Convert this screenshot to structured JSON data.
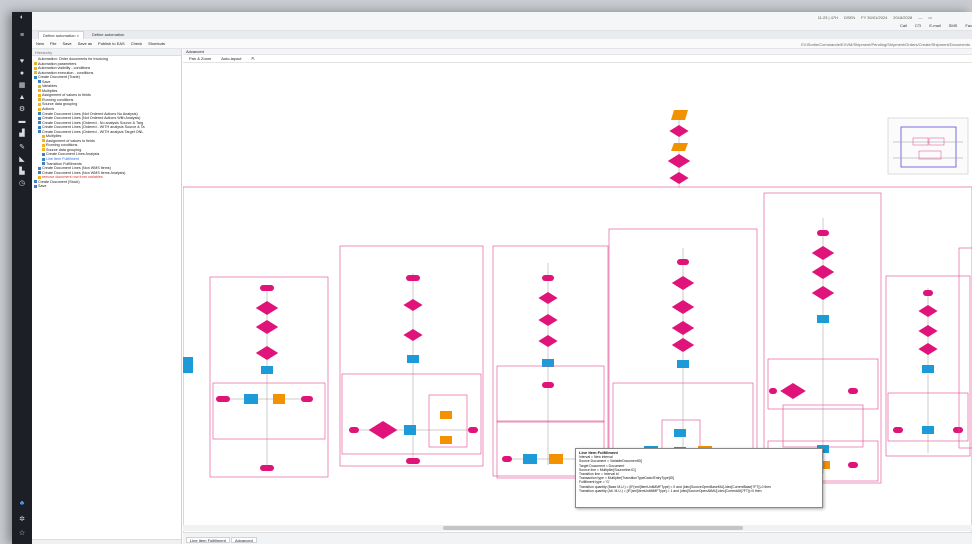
{
  "window": {
    "status_items": [
      "11:23 | 47H",
      "DSEN",
      "FY 30/01/2024",
      "2018/2028"
    ],
    "actions": [
      "Call",
      "CTI",
      "E-mail",
      "SMS",
      "Fax"
    ]
  },
  "tabs": [
    {
      "label": "Define automation"
    },
    {
      "label": "Define automation"
    }
  ],
  "toolbar": {
    "items": [
      "New",
      "File",
      "Save",
      "Save as",
      "Publish to EAS",
      "Check",
      "Shortcuts"
    ],
    "path": "EXISortie/Commande/EXVM/Shipment/Pending/Shipment/Orders/Create/Shipment/Documents"
  },
  "hierarchy": {
    "header": "Hierarchy",
    "items": [
      {
        "label": "Automation: Order documents for invoicing",
        "indent": 0,
        "icon": "none",
        "color": "#222"
      },
      {
        "label": "Automation parameters",
        "indent": 0,
        "icon": "folder",
        "color": "#222"
      },
      {
        "label": "Automation visibility - conditions",
        "indent": 0,
        "icon": "folder",
        "color": "#222"
      },
      {
        "label": "Automation execution - conditions",
        "indent": 0,
        "icon": "folder",
        "color": "#222"
      },
      {
        "label": "Create Document (Trade)",
        "indent": 0,
        "icon": "doc",
        "color": "#222"
      },
      {
        "label": "Save",
        "indent": 1,
        "icon": "doc",
        "color": "#222"
      },
      {
        "label": "Variables",
        "indent": 1,
        "icon": "folder",
        "color": "#222"
      },
      {
        "label": "Multiplies",
        "indent": 1,
        "icon": "folder",
        "color": "#222"
      },
      {
        "label": "Assignment of values to fields",
        "indent": 1,
        "icon": "folder",
        "color": "#222"
      },
      {
        "label": "Running conditions",
        "indent": 1,
        "icon": "folder",
        "color": "#222"
      },
      {
        "label": "Source data grouping",
        "indent": 1,
        "icon": "folder",
        "color": "#222"
      },
      {
        "label": "Actions",
        "indent": 1,
        "icon": "folder",
        "color": "#222"
      },
      {
        "label": "Create Document Lines (Not Ordered Actions No Analysis)",
        "indent": 1,
        "icon": "doc",
        "color": "#222"
      },
      {
        "label": "Create Document Lines (Not Ordered Actions With Analysis)",
        "indent": 1,
        "icon": "doc",
        "color": "#222"
      },
      {
        "label": "Create Document Lines (Ordered - No analysis Source & Targ",
        "indent": 1,
        "icon": "doc",
        "color": "#222"
      },
      {
        "label": "Create Document Lines (Ordered - WITH analysis Source & Ta",
        "indent": 1,
        "icon": "doc",
        "color": "#222"
      },
      {
        "label": "Create Document Lines (Ordered - WITH analysis Target ONL",
        "indent": 1,
        "icon": "doc",
        "color": "#222"
      },
      {
        "label": "Multiplies",
        "indent": 2,
        "icon": "folder",
        "color": "#222"
      },
      {
        "label": "Assignment of values to fields",
        "indent": 2,
        "icon": "folder",
        "color": "#222"
      },
      {
        "label": "Running conditions",
        "indent": 2,
        "icon": "folder",
        "color": "#222"
      },
      {
        "label": "Source data grouping",
        "indent": 2,
        "icon": "folder",
        "color": "#222"
      },
      {
        "label": "Create Document Lines Analysis",
        "indent": 2,
        "icon": "doc",
        "color": "#222"
      },
      {
        "label": "Line Item Fulfillment",
        "indent": 2,
        "icon": "doc",
        "color": "#2a6fd6"
      },
      {
        "label": "Transition Fulfillments",
        "indent": 2,
        "icon": "doc",
        "color": "#222"
      },
      {
        "label": "Create Document Lines (Non WMS items)",
        "indent": 1,
        "icon": "doc",
        "color": "#222"
      },
      {
        "label": "Create Document Lines (Non WMS items Analysis)",
        "indent": 1,
        "icon": "doc",
        "color": "#222"
      },
      {
        "label": "remove document row from variables",
        "indent": 1,
        "icon": "warn",
        "color": "#d32f2f"
      },
      {
        "label": "Create Document (Stock)",
        "indent": 0,
        "icon": "doc",
        "color": "#222"
      },
      {
        "label": "Save",
        "indent": 0,
        "icon": "doc",
        "color": "#222"
      }
    ]
  },
  "editor": {
    "title": "Advanced",
    "tools": [
      "Pan & Zoom",
      "Auto-layout"
    ]
  },
  "tooltip": {
    "title": "Line Item Fulfillment",
    "lines": [
      "Interval = New interval",
      "Source Document = VariableDocumentID]",
      "Target Document = Document",
      "Source line = Multiplier[Sourceline.ID]",
      "Transition line = Interval id",
      "Transaction type = Multiplier[TransitionTypeData fEntryType]ID]",
      "Fulfillment type = 'G'",
      "Transition quantity (Base M.U.) = [IF(xml[ItemUnitMMFType] = 0 and (idec[SourceOpenBaseMU]-idec[CurrentBase]?FT))-0 then",
      "Transition quantity (Alt. M.U.) = [IF(xml[ItemUnitMMFType] = 1 and (idec[SourceOpenAltMU]-idec[CurrentAlt]?FT))>0 then"
    ]
  },
  "bottom_tabs": [
    "Line Item Fulfillment",
    "Advanced"
  ],
  "colors": {
    "process": "#e0137a",
    "action": "#1d9bd8",
    "accent": "#f39200",
    "group_border": "#e24a8f"
  }
}
